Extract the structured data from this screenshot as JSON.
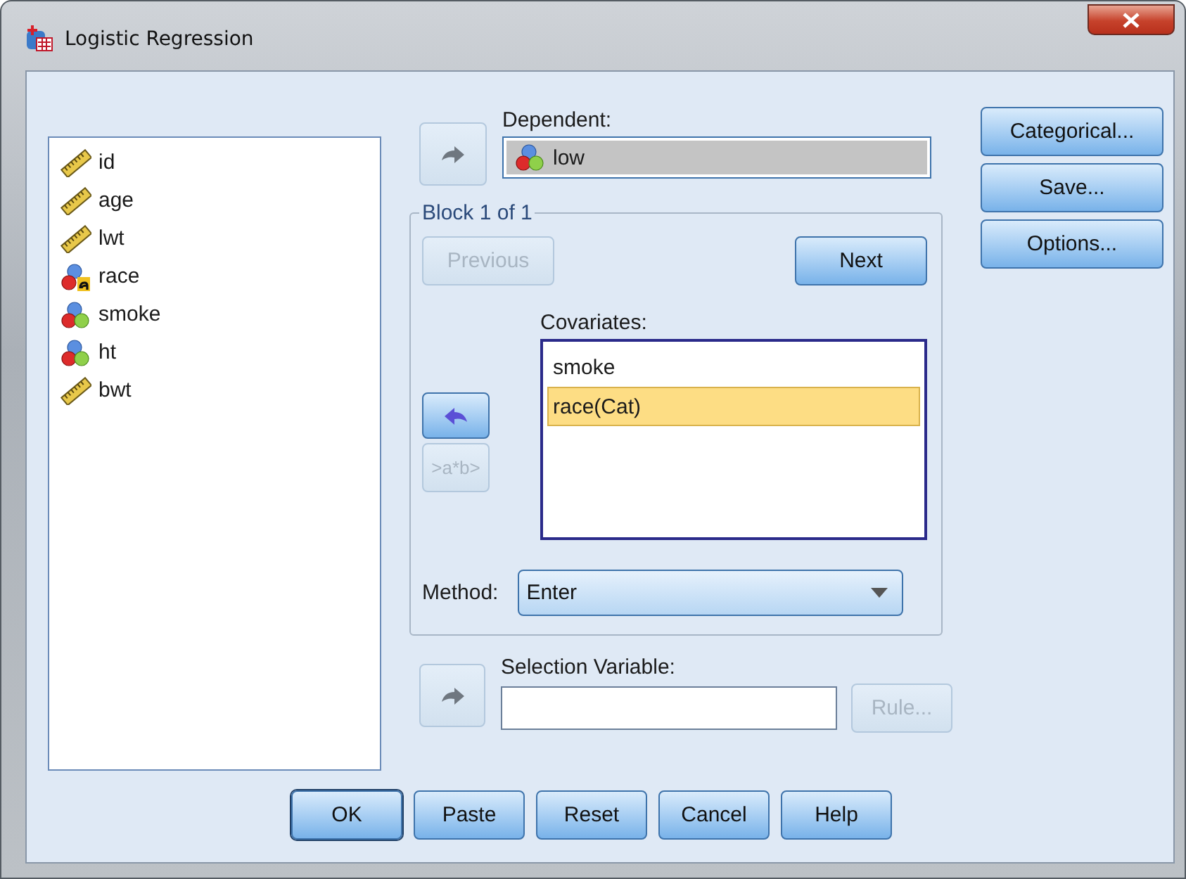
{
  "window": {
    "title": "Logistic Regression"
  },
  "variables": [
    {
      "name": "id",
      "kind": "scale"
    },
    {
      "name": "age",
      "kind": "scale"
    },
    {
      "name": "lwt",
      "kind": "scale"
    },
    {
      "name": "race",
      "kind": "nominal_string"
    },
    {
      "name": "smoke",
      "kind": "nominal"
    },
    {
      "name": "ht",
      "kind": "nominal"
    },
    {
      "name": "bwt",
      "kind": "scale"
    }
  ],
  "dependent": {
    "label": "Dependent:",
    "value": "low",
    "kind": "nominal",
    "arrow_disabled": true
  },
  "block": {
    "title": "Block 1 of 1",
    "previous": {
      "label": "Previous",
      "disabled": true
    },
    "next": {
      "label": "Next",
      "disabled": false
    },
    "covariates_label": "Covariates:",
    "covariates": [
      {
        "label": "smoke",
        "selected": false
      },
      {
        "label": "race(Cat)",
        "selected": true
      }
    ],
    "arrow_disabled": false,
    "interaction": {
      "label": ">a*b>",
      "disabled": true
    },
    "method": {
      "label": "Method:",
      "value": "Enter"
    }
  },
  "selection": {
    "label": "Selection Variable:",
    "arrow_disabled": true,
    "rule": {
      "label": "Rule...",
      "disabled": true
    }
  },
  "side_buttons": [
    "Categorical...",
    "Save...",
    "Options..."
  ],
  "buttons": [
    {
      "label": "OK",
      "default": true
    },
    {
      "label": "Paste",
      "default": false
    },
    {
      "label": "Reset",
      "default": false
    },
    {
      "label": "Cancel",
      "default": false
    },
    {
      "label": "Help",
      "default": false
    }
  ]
}
